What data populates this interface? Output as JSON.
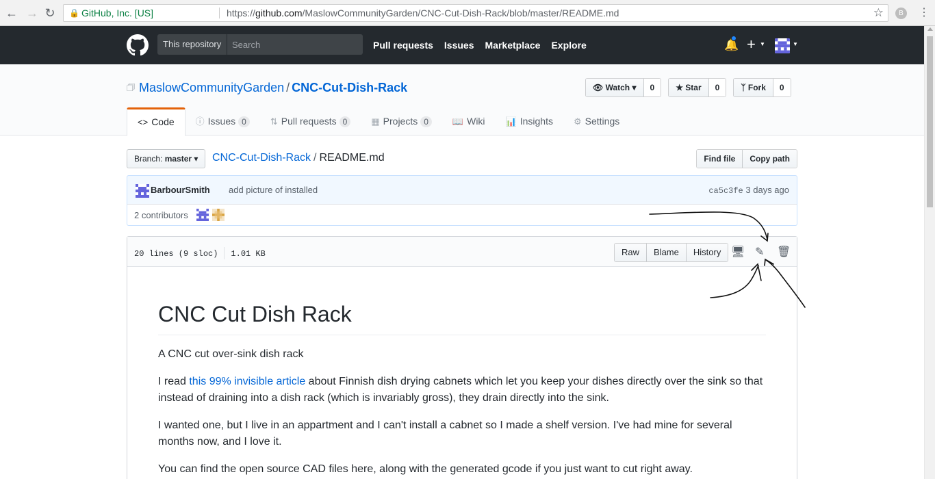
{
  "browser": {
    "ev_name": "GitHub, Inc. [US]",
    "url_prefix": "https://",
    "url_host": "github.com",
    "url_path": "/MaslowCommunityGarden/CNC-Cut-Dish-Rack/blob/master/README.md",
    "profile_initial": "B"
  },
  "header": {
    "scope_label": "This repository",
    "search_placeholder": "Search",
    "nav": [
      "Pull requests",
      "Issues",
      "Marketplace",
      "Explore"
    ]
  },
  "repo": {
    "owner": "MaslowCommunityGarden",
    "separator": "/",
    "name": "CNC-Cut-Dish-Rack",
    "watch_label": "Watch",
    "watch_count": "0",
    "star_label": "Star",
    "star_count": "0",
    "fork_label": "Fork",
    "fork_count": "0",
    "tabs": [
      {
        "label": "Code",
        "count": null
      },
      {
        "label": "Issues",
        "count": "0"
      },
      {
        "label": "Pull requests",
        "count": "0"
      },
      {
        "label": "Projects",
        "count": "0"
      },
      {
        "label": "Wiki",
        "count": null
      },
      {
        "label": "Insights",
        "count": null
      },
      {
        "label": "Settings",
        "count": null
      }
    ]
  },
  "file_nav": {
    "branch_prefix": "Branch:",
    "branch": "master",
    "repo_link": "CNC-Cut-Dish-Rack",
    "separator": "/",
    "file_name": "README.md",
    "find_file": "Find file",
    "copy_path": "Copy path"
  },
  "commit": {
    "author": "BarbourSmith",
    "message": "add picture of installed",
    "sha": "ca5c3fe",
    "time": "3 days ago",
    "contributors": "2 contributors"
  },
  "file": {
    "lines": "20 lines (9 sloc)",
    "size": "1.01 KB",
    "raw": "Raw",
    "blame": "Blame",
    "history": "History"
  },
  "readme": {
    "title": "CNC Cut Dish Rack",
    "p1": "A CNC cut over-sink dish rack",
    "p2_prefix": "I read ",
    "p2_link": "this 99% invisible article",
    "p2_suffix": " about Finnish dish drying cabnets which let you keep your dishes directly over the sink so that instead of draining into a dish rack (which is invariably gross), they drain directly into the sink.",
    "p3": "I wanted one, but I live in an appartment and I can't install a cabnet so I made a shelf version. I've had mine for several months now, and I love it.",
    "p4": "You can find the open source CAD files here, along with the generated gcode if you just want to cut right away."
  },
  "colors": {
    "header_bg": "#24292e",
    "link": "#0366d6",
    "tab_accent": "#e36209",
    "commit_bg": "#f1f8ff"
  }
}
